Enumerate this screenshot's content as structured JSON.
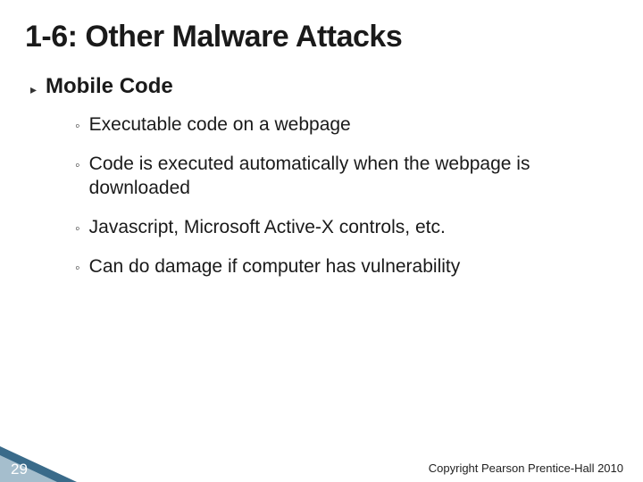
{
  "title": "1-6: Other Malware Attacks",
  "main_bullet": {
    "icon": "▸",
    "text": "Mobile Code"
  },
  "sub_bullets": [
    {
      "icon": "◦",
      "text": "Executable code on a webpage"
    },
    {
      "icon": "◦",
      "text": "Code is executed automatically when the webpage is downloaded"
    },
    {
      "icon": "◦",
      "text": "Javascript, Microsoft Active-X controls, etc."
    },
    {
      "icon": "◦",
      "text": "Can do damage if computer has vulnerability"
    }
  ],
  "page_number": "29",
  "copyright": "Copyright Pearson Prentice-Hall 2010"
}
